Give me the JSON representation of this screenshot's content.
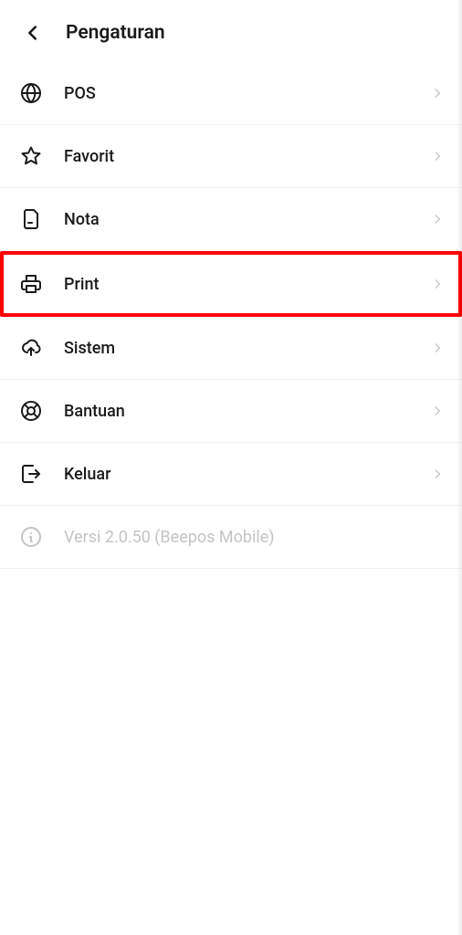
{
  "header": {
    "title": "Pengaturan"
  },
  "menu": {
    "pos": "POS",
    "favorit": "Favorit",
    "nota": "Nota",
    "print": "Print",
    "sistem": "Sistem",
    "bantuan": "Bantuan",
    "keluar": "Keluar"
  },
  "version": "Versi 2.0.50 (Beepos Mobile)",
  "highlighted": "print"
}
